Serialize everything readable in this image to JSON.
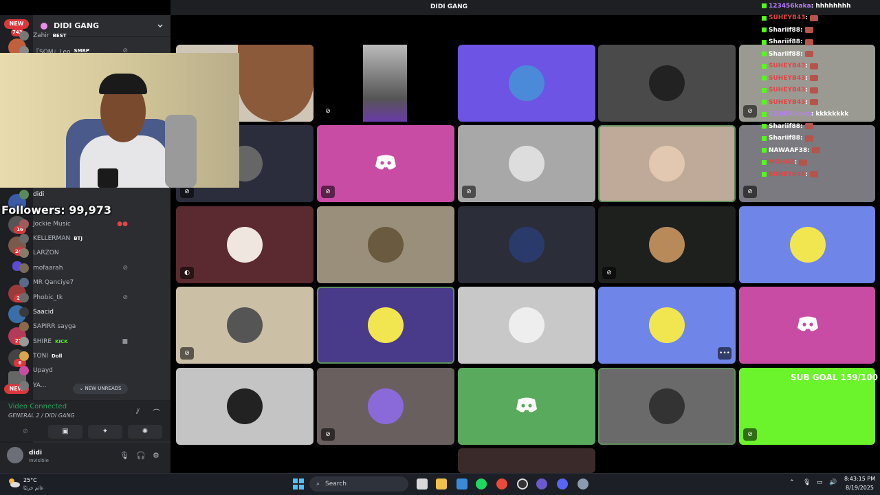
{
  "window": {
    "title": "DIDI GANG"
  },
  "rail": {
    "top_badge": "NEW",
    "top_count": "743",
    "bottom_badge": "NEW",
    "counts": [
      "16",
      "247",
      "27",
      "272",
      "6"
    ]
  },
  "server": {
    "name": "DIDI GANG"
  },
  "members": [
    {
      "name": "Zahir",
      "tag": "BEST"
    },
    {
      "name": "『SOM』Leo",
      "tag": "SMRP"
    },
    {
      "name": "didi",
      "tag": ""
    },
    {
      "name": "Jockie Music",
      "tag": ""
    },
    {
      "name": "KELLERMAN",
      "tag": "BTJ"
    },
    {
      "name": "LARZON",
      "tag": ""
    },
    {
      "name": "mofaarah",
      "tag": ""
    },
    {
      "name": "MR Qanciye7",
      "tag": ""
    },
    {
      "name": "Phobic_tk",
      "tag": ""
    },
    {
      "name": "Saacid",
      "tag": ""
    },
    {
      "name": "SAPIRR sayga",
      "tag": ""
    },
    {
      "name": "SHIRE",
      "tag": "KICK"
    },
    {
      "name": "TONI",
      "tag": "Doll"
    },
    {
      "name": "Upayd",
      "tag": ""
    },
    {
      "name": "YA...",
      "tag": ""
    }
  ],
  "new_unreads": "NEW UNREADS",
  "voice": {
    "status": "Video Connected",
    "channel": "GENERAL 2 / DIDI GANG"
  },
  "user": {
    "name": "didi",
    "status": "Invisible"
  },
  "overlay": {
    "followers": "Followers: 99,973",
    "sub_goal": "SUB GOAL 159/100"
  },
  "chat": [
    {
      "user": "123456kaka",
      "msg": "hhhhhhhh",
      "color": "#b97cff",
      "emote": false
    },
    {
      "user": "SUHEYB43",
      "msg": "",
      "color": "#e04646",
      "emote": true
    },
    {
      "user": "Shariif88",
      "msg": "",
      "color": "#ffffff",
      "emote": true
    },
    {
      "user": "Shariif88",
      "msg": "",
      "color": "#ffffff",
      "emote": true
    },
    {
      "user": "Shariif88",
      "msg": "",
      "color": "#ffffff",
      "emote": true
    },
    {
      "user": "SUHEYB43",
      "msg": "",
      "color": "#e04646",
      "emote": true
    },
    {
      "user": "SUHEYB43",
      "msg": "",
      "color": "#e04646",
      "emote": true
    },
    {
      "user": "SUHEYB43",
      "msg": "",
      "color": "#e04646",
      "emote": true
    },
    {
      "user": "SUHEYB43",
      "msg": "",
      "color": "#e04646",
      "emote": true
    },
    {
      "user": "123456kaka",
      "msg": "kkkkkkkk",
      "color": "#b97cff",
      "emote": false
    },
    {
      "user": "Shariif88",
      "msg": "",
      "color": "#ffffff",
      "emote": true
    },
    {
      "user": "Shariif88",
      "msg": "",
      "color": "#ffffff",
      "emote": true
    },
    {
      "user": "NAWAAF38",
      "msg": "",
      "color": "#ffffff",
      "emote": true
    },
    {
      "user": "MOHAZ",
      "msg": "",
      "color": "#e04646",
      "emote": true
    },
    {
      "user": "SUHEYB43",
      "msg": "",
      "color": "#e04646",
      "emote": true
    }
  ],
  "taskbar": {
    "weather_temp": "25°C",
    "weather_cond": "غائم جزئيًا",
    "search_placeholder": "Search",
    "time": "8:43:15 PM",
    "date": "8/19/2025"
  },
  "colors": {
    "discord_blurple": "#5865f2",
    "pink": "#c94ca4",
    "green": "#5aaa5e",
    "kick_green": "#6bf32c",
    "voice_green": "#23a55a"
  }
}
